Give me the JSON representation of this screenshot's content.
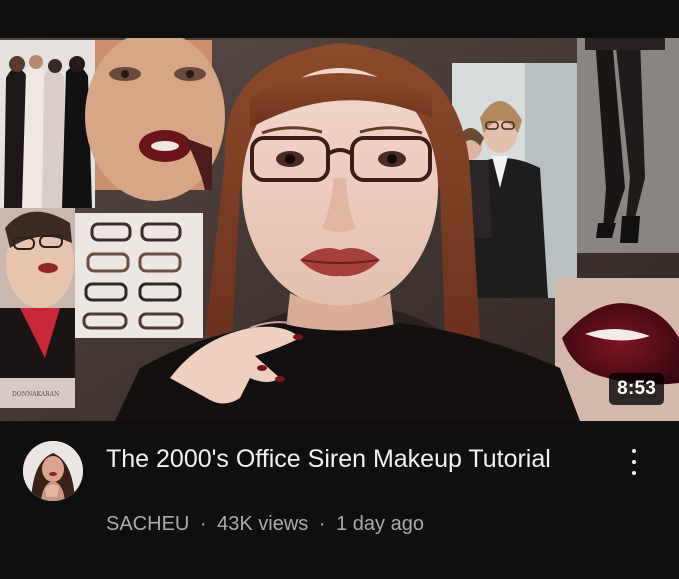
{
  "video": {
    "duration": "8:53",
    "title": "The 2000's Office Siren Makeup Tutorial",
    "channel": "SACHEU",
    "views": "43K views",
    "age": "1 day ago",
    "separator": "·"
  },
  "thumbnail": {
    "collage_text": "DONNAKARAN"
  },
  "icons": {
    "more": "more-vertical-icon",
    "avatar": "channel-avatar"
  },
  "colors": {
    "background": "#0f0f0f",
    "title_text": "#f1f1f1",
    "secondary_text": "#aaaaaa",
    "duration_badge": "#000000"
  }
}
